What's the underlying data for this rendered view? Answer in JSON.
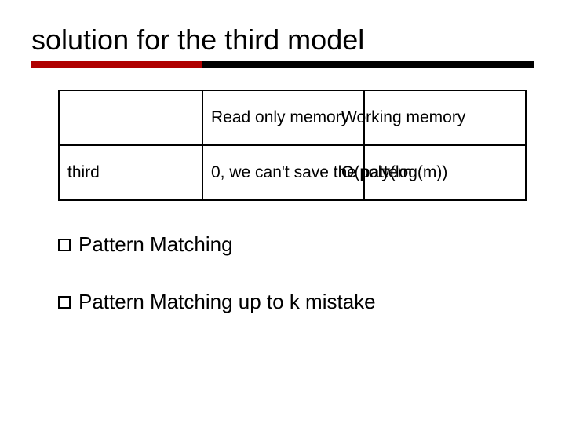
{
  "title": "solution for the third model",
  "table": {
    "header_col2": "Read only memory",
    "header_col3": "Working memory",
    "row1_label": "third",
    "row1_col2": "0, we can't save the pattern",
    "row1_col3": "O(poly(log(m))"
  },
  "bullets": {
    "b1": "Pattern Matching",
    "b2": "Pattern Matching up to k mistake"
  }
}
